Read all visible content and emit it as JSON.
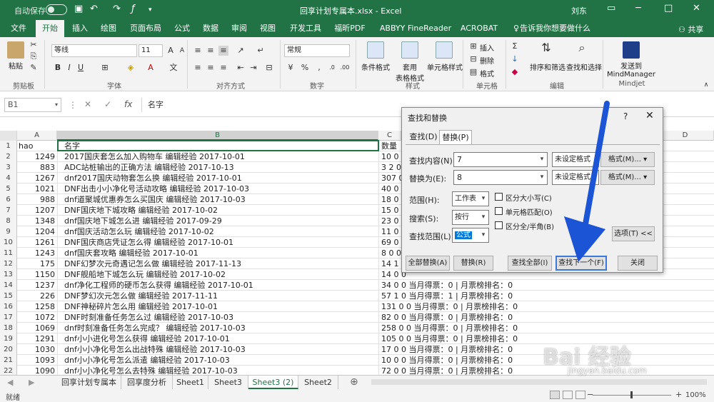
{
  "titlebar": {
    "autosave": "自动保存",
    "toggle_state": "关",
    "doc_title": "回享计划专属本.xlsx  -  Excel",
    "user": "刘东"
  },
  "menu_tabs": [
    "文件",
    "开始",
    "插入",
    "绘图",
    "页面布局",
    "公式",
    "数据",
    "审阅",
    "视图",
    "开发工具",
    "福昕PDF",
    "ABBYY FineReader 12",
    "ACROBAT",
    "告诉我你想要做什么"
  ],
  "share": "共享",
  "ribbon": {
    "clipboard": {
      "paste": "粘贴",
      "label": "剪贴板"
    },
    "font": {
      "name": "等线",
      "size": "11",
      "bold": "B",
      "italic": "I",
      "underline": "U",
      "label": "字体"
    },
    "alignment": {
      "label": "对齐方式"
    },
    "number": {
      "format": "常规",
      "label": "数字"
    },
    "styles": {
      "conditional": "条件格式",
      "table": "套用\n表格格式",
      "cell": "单元格样式",
      "label": "样式"
    },
    "cells": {
      "insert": "插入",
      "delete": "删除",
      "format": "格式",
      "label": "单元格"
    },
    "editing": {
      "sort": "排序和筛选",
      "find": "查找和选择",
      "label": "编辑"
    },
    "mindjet": {
      "send": "发送到\nMindManager",
      "label": "Mindjet"
    }
  },
  "formula_bar": {
    "name_box": "B1",
    "fx": "fx",
    "content": "名字"
  },
  "columns": [
    "A",
    "B",
    "C",
    "D"
  ],
  "selected_column": "B",
  "rows": [
    {
      "n": "1",
      "a": "hao",
      "b": "名字",
      "c": "数量"
    },
    {
      "n": "2",
      "a": "1249",
      "b": "2017国庆套怎么加入购物车 编辑经验 2017-10-01",
      "c": "10 0 0"
    },
    {
      "n": "3",
      "a": "883",
      "b": "ADC站桩输出的正确方法 编辑经验 2017-10-13",
      "c": "3 2 0"
    },
    {
      "n": "4",
      "a": "1267",
      "b": "dnf2017国庆动物套怎么换 编辑经验 2017-10-01",
      "c": "307 0"
    },
    {
      "n": "5",
      "a": "1021",
      "b": "DNF出击小小净化号活动攻略 编辑经验 2017-10-03",
      "c": "40 0 0"
    },
    {
      "n": "6",
      "a": "988",
      "b": "dnf道聚城优惠券怎么买国庆 编辑经验 2017-10-03",
      "c": "18 0 0"
    },
    {
      "n": "7",
      "a": "1207",
      "b": "DNF国庆地下城攻略 编辑经验 2017-10-02",
      "c": "15 0 0"
    },
    {
      "n": "8",
      "a": "1348",
      "b": "dnf国庆地下城怎么进 编辑经验 2017-09-29",
      "c": "23 0 0"
    },
    {
      "n": "9",
      "a": "1204",
      "b": "dnf国庆活动怎么玩 编辑经验 2017-10-02",
      "c": "11 0 0"
    },
    {
      "n": "10",
      "a": "1261",
      "b": "DNF国庆商店凭证怎么得 编辑经验 2017-10-01",
      "c": "69 0 0"
    },
    {
      "n": "11",
      "a": "1243",
      "b": "dnf国庆套攻略 编辑经验 2017-10-01",
      "c": "8 0 0"
    },
    {
      "n": "12",
      "a": "175",
      "b": "DNF幻梦次元奇遇记怎么做 编辑经验 2017-11-13",
      "c": "14 1 0"
    },
    {
      "n": "13",
      "a": "1150",
      "b": "DNF舰船地下城怎么玩 编辑经验 2017-10-02",
      "c": "14 0 0"
    },
    {
      "n": "14",
      "a": "1237",
      "b": "dnf净化工程师的硬币怎么获得 编辑经验 2017-10-01",
      "c": "34 0 0 当月得票：0 | 月票榜排名：0"
    },
    {
      "n": "15",
      "a": "226",
      "b": "DNF梦幻次元怎么做 编辑经验 2017-11-11",
      "c": "57 1 0 当月得票：1 | 月票榜排名：0"
    },
    {
      "n": "16",
      "a": "1258",
      "b": "DNF神秘碎片怎么用 编辑经验 2017-10-01",
      "c": "131 0 0 当月得票：0 | 月票榜排名：0"
    },
    {
      "n": "17",
      "a": "1072",
      "b": "DNF时刻准备任务怎么过 编辑经验 2017-10-03",
      "c": "82 0 0 当月得票：0 | 月票榜排名：0"
    },
    {
      "n": "18",
      "a": "1069",
      "b": "dnf时刻准备任务怎么完成？ 编辑经验 2017-10-03",
      "c": "258 0 0 当月得票：0 | 月票榜排名：0"
    },
    {
      "n": "19",
      "a": "1291",
      "b": "dnf小小进化号怎么获得 编辑经验 2017-10-01",
      "c": "105 0 0 当月得票：0 | 月票榜排名：0"
    },
    {
      "n": "20",
      "a": "1030",
      "b": "dnf小小净化号怎么出战特殊 编辑经验 2017-10-03",
      "c": "17 0 0 当月得票：0 | 月票榜排名：0"
    },
    {
      "n": "21",
      "a": "1093",
      "b": "dnf小小净化号怎么派遣 编辑经验 2017-10-03",
      "c": "10 0 0 当月得票：0 | 月票榜排名：0"
    },
    {
      "n": "22",
      "a": "1090",
      "b": "dnf小小净化号怎么去特殊 编辑经验 2017-10-03",
      "c": "72 0 0 当月得票：0 | 月票榜排名：0"
    }
  ],
  "sheet_tabs": [
    "回享计划专属本",
    "回享度分析",
    "Sheet1",
    "Sheet3",
    "Sheet3 (2)",
    "Sheet2"
  ],
  "active_sheet": "Sheet3 (2)",
  "status": {
    "ready": "就绪",
    "zoom": "100%",
    "zoom_level_percent": 100
  },
  "dialog": {
    "title": "查找和替换",
    "help": "?",
    "tabs": [
      "查找(D)",
      "替换(P)"
    ],
    "active_tab": "替换(P)",
    "find_label": "查找内容(N):",
    "find_value": "7",
    "replace_label": "替换为(E):",
    "replace_value": "8",
    "no_format_1": "未设定格式",
    "no_format_2": "未设定格式",
    "format_btn_1": "格式(M)...",
    "format_btn_2": "格式(M)...",
    "within_label": "范围(H):",
    "within_value": "工作表",
    "search_label": "搜索(S):",
    "search_value": "按行",
    "lookin_label": "查找范围(L):",
    "lookin_value": "公式",
    "match_case": "区分大小写(C)",
    "match_cell": "单元格匹配(O)",
    "match_width": "区分全/半角(B)",
    "options_btn": "选项(T) <<",
    "replace_all": "全部替换(A)",
    "replace": "替换(R)",
    "find_all": "查找全部(I)",
    "find_next": "查找下一个(F)",
    "close": "关闭"
  },
  "colors": {
    "excel_green": "#217346",
    "arrow_blue": "#1c54d6",
    "dialog_accent": "#3b78d8"
  },
  "watermark": {
    "brand": "Bai 经验",
    "url": "jingyan.baidu.com"
  }
}
